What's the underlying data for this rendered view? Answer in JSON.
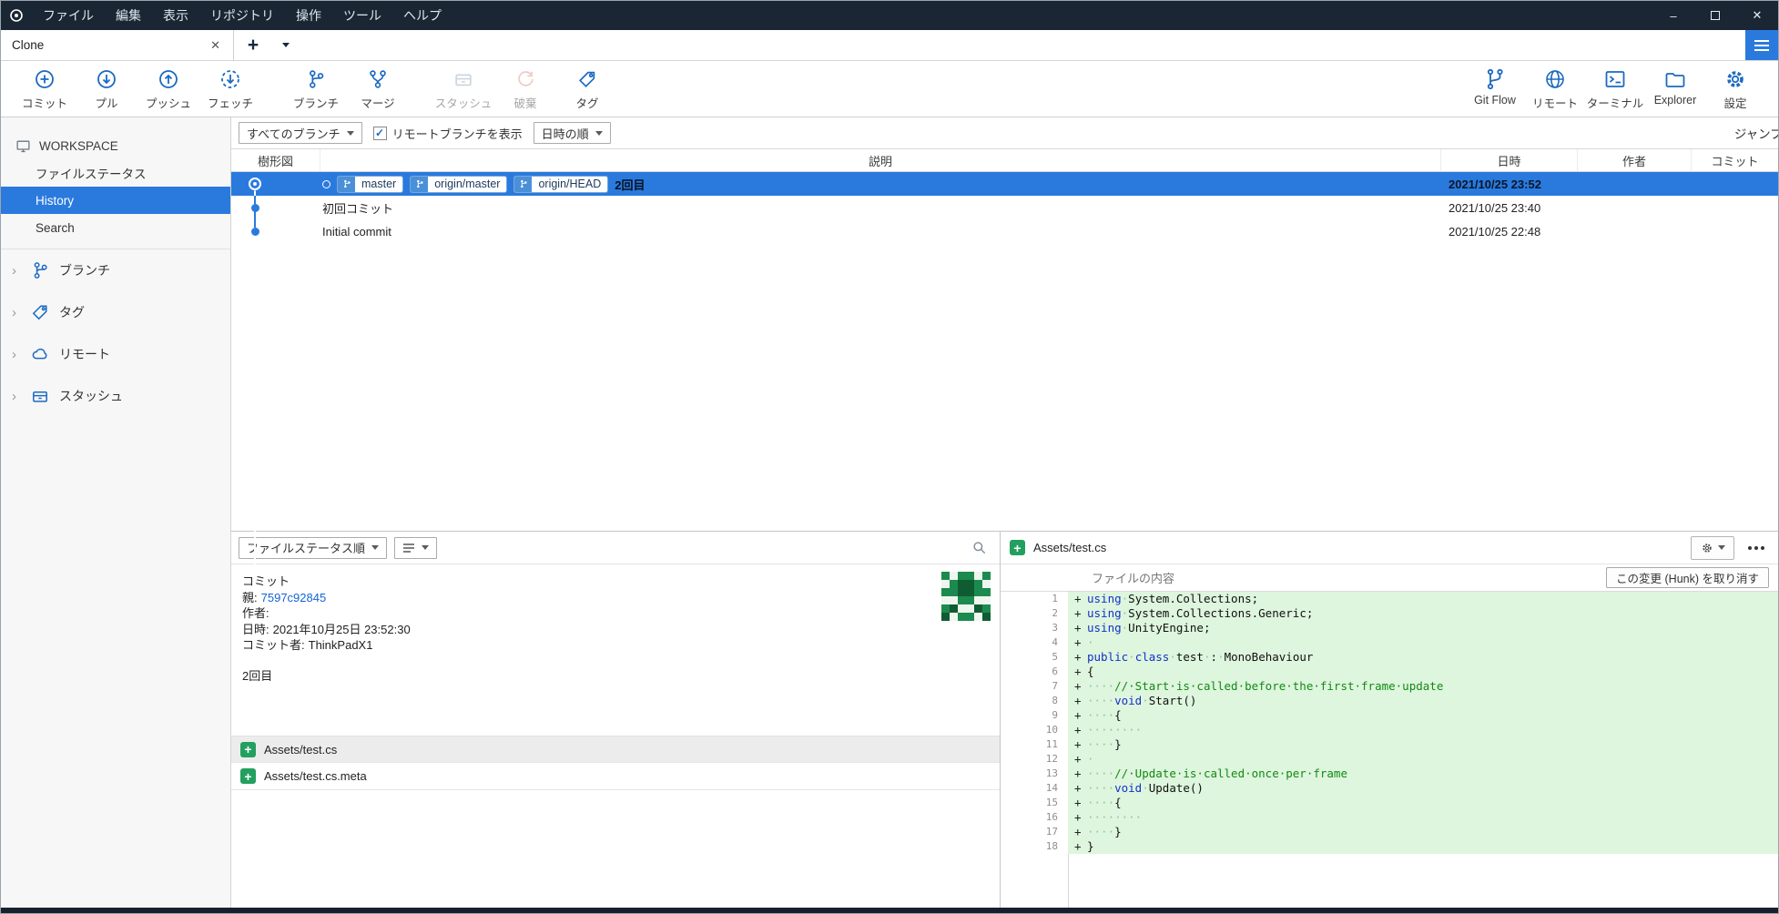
{
  "window": {
    "menu": [
      "ファイル",
      "編集",
      "表示",
      "リポジトリ",
      "操作",
      "ツール",
      "ヘルプ"
    ],
    "controls": {
      "minimize": "–",
      "close": "✕"
    }
  },
  "tabstrip": {
    "active_tab": "Clone",
    "close_glyph": "✕"
  },
  "toolbar": {
    "left": [
      {
        "id": "commit",
        "label": "コミット",
        "icon": "commit-icon",
        "disabled": false,
        "group": false
      },
      {
        "id": "pull",
        "label": "プル",
        "icon": "pull-icon",
        "disabled": false,
        "group": false
      },
      {
        "id": "push",
        "label": "プッシュ",
        "icon": "push-icon",
        "disabled": false,
        "group": false
      },
      {
        "id": "fetch",
        "label": "フェッチ",
        "icon": "fetch-icon",
        "disabled": false,
        "group": false
      },
      {
        "id": "branch",
        "label": "ブランチ",
        "icon": "branch-icon",
        "disabled": false,
        "group": true
      },
      {
        "id": "merge",
        "label": "マージ",
        "icon": "merge-icon",
        "disabled": false,
        "group": false
      },
      {
        "id": "stash",
        "label": "スタッシュ",
        "icon": "stash-icon",
        "disabled": true,
        "group": true
      },
      {
        "id": "discard",
        "label": "破棄",
        "icon": "discard-icon",
        "disabled": true,
        "group": false
      },
      {
        "id": "tag",
        "label": "タグ",
        "icon": "tag-icon",
        "disabled": false,
        "group": false
      }
    ],
    "right": [
      {
        "id": "gitflow",
        "label": "Git Flow",
        "icon": "gitflow-icon"
      },
      {
        "id": "remote",
        "label": "リモート",
        "icon": "remote-icon"
      },
      {
        "id": "terminal",
        "label": "ターミナル",
        "icon": "terminal-icon"
      },
      {
        "id": "explorer",
        "label": "Explorer",
        "icon": "explorer-icon"
      },
      {
        "id": "settings",
        "label": "設定",
        "icon": "settings-icon"
      }
    ]
  },
  "sidebar": {
    "workspace_label": "WORKSPACE",
    "workspace_items": [
      {
        "id": "file-status",
        "label": "ファイルステータス",
        "selected": false
      },
      {
        "id": "history",
        "label": "History",
        "selected": true
      },
      {
        "id": "search",
        "label": "Search",
        "selected": false
      }
    ],
    "sections": [
      {
        "id": "branches",
        "label": "ブランチ",
        "icon": "branch-icon"
      },
      {
        "id": "tags",
        "label": "タグ",
        "icon": "tag-icon"
      },
      {
        "id": "remotes",
        "label": "リモート",
        "icon": "cloud-icon"
      },
      {
        "id": "stashes",
        "label": "スタッシュ",
        "icon": "stash-icon"
      }
    ]
  },
  "filter_bar": {
    "branch_filter": "すべてのブランチ",
    "remote_checkbox_label": "リモートブランチを表示",
    "remote_checked": true,
    "check_glyph": "✓",
    "sort_filter": "日時の順",
    "jump_label": "ジャンプ先:"
  },
  "history": {
    "columns": [
      "樹形図",
      "説明",
      "日時",
      "作者",
      "コミット"
    ],
    "rows": [
      {
        "selected": true,
        "current": true,
        "refs": [
          "master",
          "origin/master",
          "origin/HEAD"
        ],
        "message": "2回目",
        "date": "2021/10/25 23:52",
        "author": "",
        "commit": ""
      },
      {
        "selected": false,
        "current": false,
        "refs": [],
        "message": "初回コミット",
        "date": "2021/10/25 23:40",
        "author": "",
        "commit": ""
      },
      {
        "selected": false,
        "current": false,
        "refs": [],
        "message": "Initial commit",
        "date": "2021/10/25 22:48",
        "author": "",
        "commit": ""
      }
    ],
    "accent_color": "#2a7ade"
  },
  "commit_panel": {
    "sort_dropdown": "ファイルステータス順",
    "info_title": "コミット",
    "parent_label": "親:",
    "parent_link": "7597c92845",
    "author_label": "作者:",
    "date_label": "日時:",
    "date_value": "2021年10月25日 23:52:30",
    "committer_label": "コミット者:",
    "committer_value": "ThinkPadX1",
    "message": "2回目",
    "files": [
      {
        "name": "Assets/test.cs",
        "status": "added",
        "selected": true
      },
      {
        "name": "Assets/test.cs.meta",
        "status": "added",
        "selected": false
      }
    ]
  },
  "diff_panel": {
    "file_name": "Assets/test.cs",
    "hunk_label": "ファイルの内容",
    "discard_button": "この変更 (Hunk) を取り消す",
    "added_bg": "#def5de",
    "lines": [
      {
        "n": 1,
        "sign": "+",
        "seg": [
          [
            "k",
            "using"
          ],
          [
            "w",
            "·"
          ],
          [
            "p",
            "System.Collections;"
          ]
        ]
      },
      {
        "n": 2,
        "sign": "+",
        "seg": [
          [
            "k",
            "using"
          ],
          [
            "w",
            "·"
          ],
          [
            "p",
            "System.Collections.Generic;"
          ]
        ]
      },
      {
        "n": 3,
        "sign": "+",
        "seg": [
          [
            "k",
            "using"
          ],
          [
            "w",
            "·"
          ],
          [
            "p",
            "UnityEngine;"
          ]
        ]
      },
      {
        "n": 4,
        "sign": "+",
        "seg": [
          [
            "w",
            "·"
          ]
        ]
      },
      {
        "n": 5,
        "sign": "+",
        "seg": [
          [
            "k",
            "public"
          ],
          [
            "w",
            "·"
          ],
          [
            "k",
            "class"
          ],
          [
            "w",
            "·"
          ],
          [
            "p",
            "test"
          ],
          [
            "w",
            "·"
          ],
          [
            "p",
            ":"
          ],
          [
            "w",
            "·"
          ],
          [
            "p",
            "MonoBehaviour"
          ]
        ]
      },
      {
        "n": 6,
        "sign": "+",
        "seg": [
          [
            "p",
            "{"
          ]
        ]
      },
      {
        "n": 7,
        "sign": "+",
        "seg": [
          [
            "w",
            "····"
          ],
          [
            "c",
            "//·Start·is·called·before·the·first·frame·update"
          ]
        ]
      },
      {
        "n": 8,
        "sign": "+",
        "seg": [
          [
            "w",
            "····"
          ],
          [
            "k",
            "void"
          ],
          [
            "w",
            "·"
          ],
          [
            "p",
            "Start()"
          ]
        ]
      },
      {
        "n": 9,
        "sign": "+",
        "seg": [
          [
            "w",
            "····"
          ],
          [
            "p",
            "{"
          ]
        ]
      },
      {
        "n": 10,
        "sign": "+",
        "seg": [
          [
            "w",
            "········"
          ]
        ]
      },
      {
        "n": 11,
        "sign": "+",
        "seg": [
          [
            "w",
            "····"
          ],
          [
            "p",
            "}"
          ]
        ]
      },
      {
        "n": 12,
        "sign": "+",
        "seg": [
          [
            "w",
            "·"
          ]
        ]
      },
      {
        "n": 13,
        "sign": "+",
        "seg": [
          [
            "w",
            "····"
          ],
          [
            "c",
            "//·Update·is·called·once·per·frame"
          ]
        ]
      },
      {
        "n": 14,
        "sign": "+",
        "seg": [
          [
            "w",
            "····"
          ],
          [
            "k",
            "void"
          ],
          [
            "w",
            "·"
          ],
          [
            "p",
            "Update()"
          ]
        ]
      },
      {
        "n": 15,
        "sign": "+",
        "seg": [
          [
            "w",
            "····"
          ],
          [
            "p",
            "{"
          ]
        ]
      },
      {
        "n": 16,
        "sign": "+",
        "seg": [
          [
            "w",
            "········"
          ]
        ]
      },
      {
        "n": 17,
        "sign": "+",
        "seg": [
          [
            "w",
            "····"
          ],
          [
            "p",
            "}"
          ]
        ]
      },
      {
        "n": 18,
        "sign": "+",
        "seg": [
          [
            "p",
            "}"
          ]
        ]
      }
    ]
  }
}
